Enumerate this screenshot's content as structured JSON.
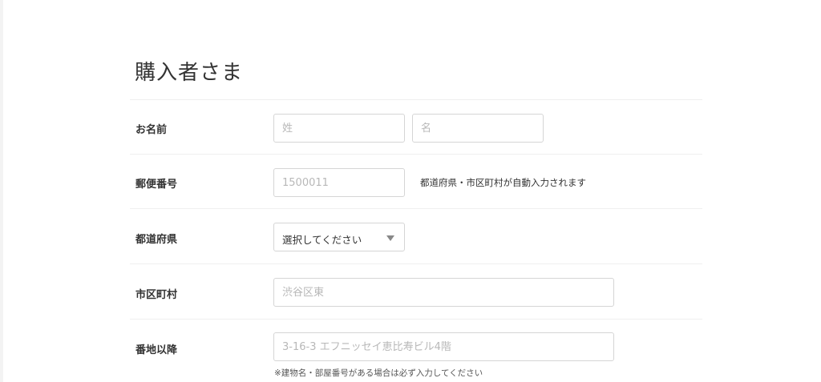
{
  "section": {
    "title": "購入者さま"
  },
  "fields": {
    "name": {
      "label": "お名前",
      "last_placeholder": "姓",
      "first_placeholder": "名"
    },
    "postal": {
      "label": "郵便番号",
      "placeholder": "1500011",
      "hint": "都道府県・市区町村が自動入力されます"
    },
    "prefecture": {
      "label": "都道府県",
      "selected": "選択してください"
    },
    "city": {
      "label": "市区町村",
      "placeholder": "渋谷区東"
    },
    "address": {
      "label": "番地以降",
      "placeholder": "3-16-3 エフニッセイ恵比寿ビル4階",
      "note": "※建物名・部屋番号がある場合は必ず入力してください"
    }
  },
  "icons": {
    "select_caret": "chevron-down-icon"
  }
}
